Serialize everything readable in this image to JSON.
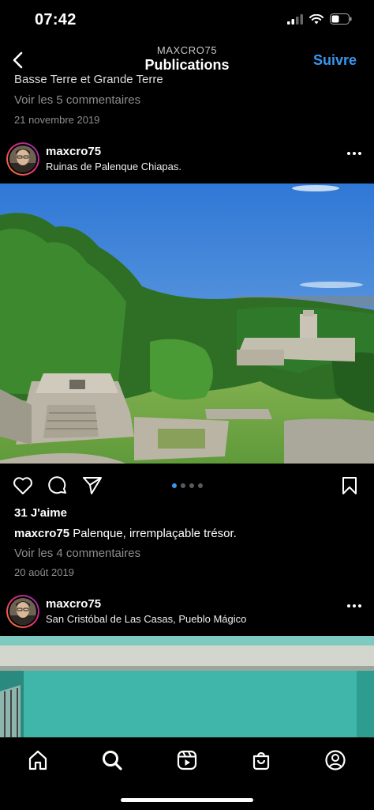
{
  "status": {
    "time": "07:42"
  },
  "nav": {
    "subtitle": "MAXCRO75",
    "title": "Publications",
    "follow_label": "Suivre"
  },
  "previous_post": {
    "caption_tail": "Basse Terre et Grande Terre",
    "comments_link": "Voir les 5 commentaires",
    "date": "21 novembre 2019"
  },
  "post": {
    "username": "maxcro75",
    "location": "Ruinas de Palenque Chiapas.",
    "carousel": {
      "count": 4,
      "active_index": 0
    },
    "likes": "31 J'aime",
    "caption_user": "maxcro75",
    "caption_text": "Palenque, irremplaçable trésor.",
    "comments_link": "Voir les 4 commentaires",
    "date": "20 août 2019"
  },
  "next_post": {
    "username": "maxcro75",
    "location": "San Cristóbal de Las Casas, Pueblo Mágico"
  },
  "tabbar": {
    "items": [
      "home-icon",
      "search-icon",
      "reels-icon",
      "shop-icon",
      "profile-icon"
    ],
    "active": "search-icon"
  },
  "colors": {
    "accent": "#3897f0",
    "background": "#000000",
    "secondary_text": "#8e8e8e"
  }
}
